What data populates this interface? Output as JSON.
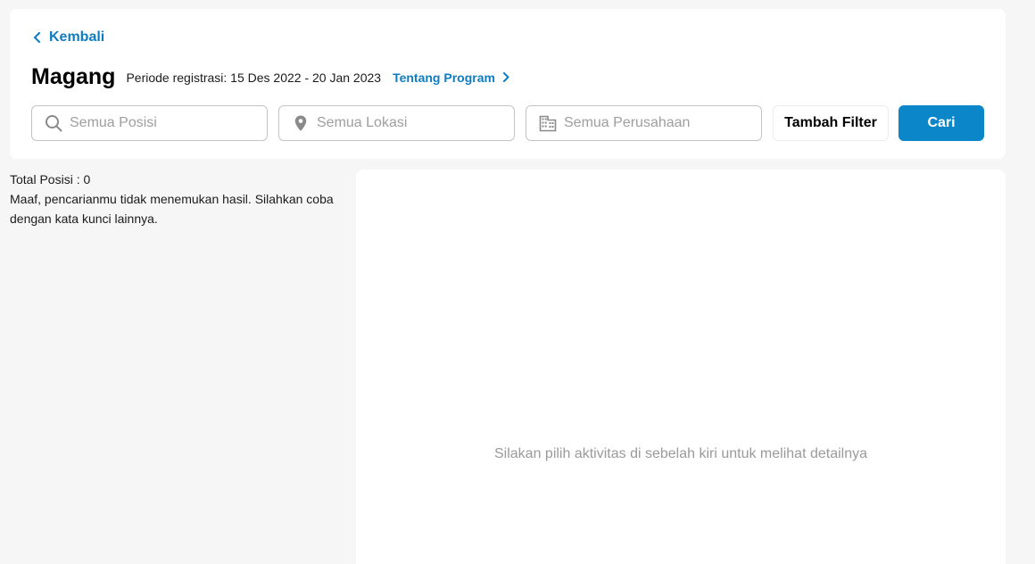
{
  "header": {
    "back_label": "Kembali",
    "title": "Magang",
    "period": "Periode registrasi: 15 Des 2022 - 20 Jan 2023",
    "about_label": "Tentang Program"
  },
  "search": {
    "position_placeholder": "Semua Posisi",
    "location_placeholder": "Semua Lokasi",
    "company_placeholder": "Semua Perusahaan",
    "filter_label": "Tambah Filter",
    "search_label": "Cari"
  },
  "results": {
    "total": "Total Posisi : 0",
    "empty_message": "Maaf, pencarianmu tidak menemukan hasil. Silahkan coba dengan kata kunci lainnya."
  },
  "detail": {
    "empty_text": "Silakan pilih aktivitas di sebelah kiri untuk melihat detailnya"
  },
  "colors": {
    "accent": "#0f7cc0",
    "button_primary": "#0a86c9",
    "background": "#f6f6f6"
  },
  "icons": {
    "back": "chevron-left-icon",
    "about": "chevron-right-icon",
    "position": "search-icon",
    "location": "location-pin-icon",
    "company": "building-icon"
  }
}
